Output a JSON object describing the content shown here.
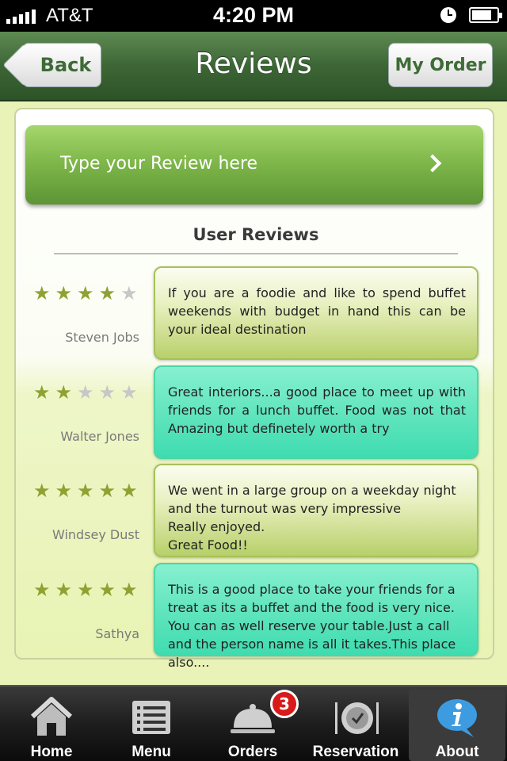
{
  "status_bar": {
    "carrier": "AT&T",
    "time": "4:20 PM"
  },
  "nav": {
    "title": "Reviews",
    "back_label": "Back",
    "my_order_label": "My Order"
  },
  "review_input": {
    "placeholder": "Type your Review here"
  },
  "section_title": "User Reviews",
  "reviews": [
    {
      "name": "Steven Jobs",
      "rating": 4,
      "max_rating": 5,
      "style": "green",
      "text": "If you are a foodie and like to spend buffet weekends with budget in hand this can be your ideal destination"
    },
    {
      "name": "Walter Jones",
      "rating": 2,
      "max_rating": 5,
      "style": "teal",
      "text": "Great interiors...a good place to meet up with friends for a lunch buffet. Food was not that Amazing but definetely worth a try"
    },
    {
      "name": "Windsey Dust",
      "rating": 5,
      "max_rating": 5,
      "style": "green",
      "text": "We went in a large group on a weekday night and the turnout was very impressive\nReally enjoyed.\nGreat Food!!"
    },
    {
      "name": "Sathya",
      "rating": 5,
      "max_rating": 5,
      "style": "teal",
      "text": "This is a good place to take your friends for a treat as its a buffet and the food is very nice.\nYou can as well reserve your table.Just a call and the person name is all it takes.This place also...."
    }
  ],
  "tabs": [
    {
      "label": "Home",
      "icon": "home-icon",
      "active": false
    },
    {
      "label": "Menu",
      "icon": "menu-icon",
      "active": false
    },
    {
      "label": "Orders",
      "icon": "orders-icon",
      "active": false,
      "badge": "3"
    },
    {
      "label": "Reservation",
      "icon": "reservation-icon",
      "active": false
    },
    {
      "label": "About",
      "icon": "about-icon",
      "active": true
    }
  ],
  "colors": {
    "nav_green": "#3d6636",
    "star_on": "#8ea232",
    "star_off": "#c7c7c7",
    "badge_red": "#d91a1a"
  }
}
